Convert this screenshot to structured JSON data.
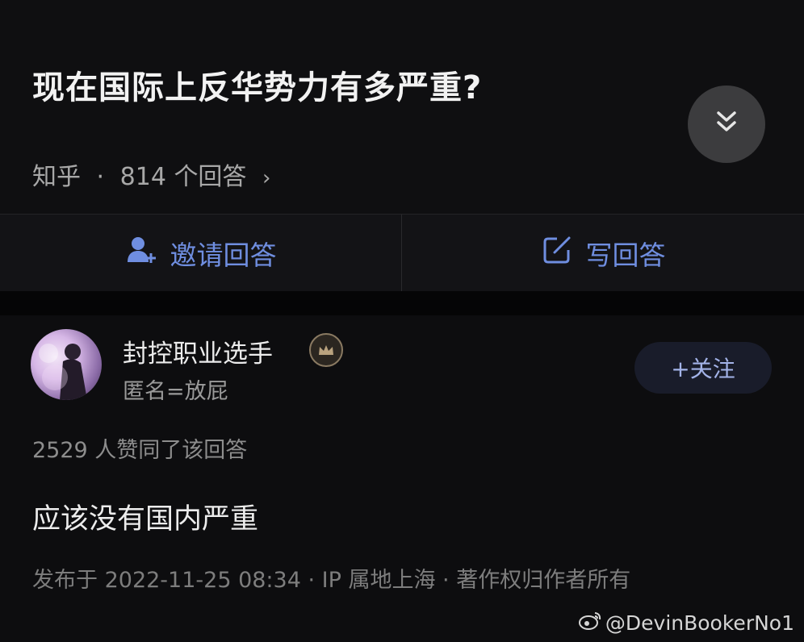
{
  "question": {
    "title": "现在国际上反华势力有多严重?",
    "source": "知乎",
    "dot": "·",
    "answer_count_text": "814 个回答",
    "chevron": "›"
  },
  "actions": {
    "invite_label": "邀请回答",
    "write_label": "写回答"
  },
  "answer": {
    "author_name": "封控职业选手",
    "author_bio": "匿名=放屁",
    "follow_label": "+关注",
    "vote_text": "2529 人赞同了该回答",
    "content": "应该没有国内严重",
    "publish_info": "发布于 2022-11-25 08:34 · IP 属地上海 · 著作权归作者所有"
  },
  "watermark": {
    "handle": "@DevinBookerNo1"
  },
  "icons": {
    "collapse": "double-chevron-down-icon",
    "invite": "add-user-icon",
    "write": "edit-icon",
    "badge": "crown-badge-icon",
    "watermark": "weibo-logo-icon"
  },
  "colors": {
    "background": "#0d0d0f",
    "accent_blue": "#6f8ee0",
    "follow_button_bg": "#191c2a",
    "badge_gold": "#8a7a62"
  }
}
